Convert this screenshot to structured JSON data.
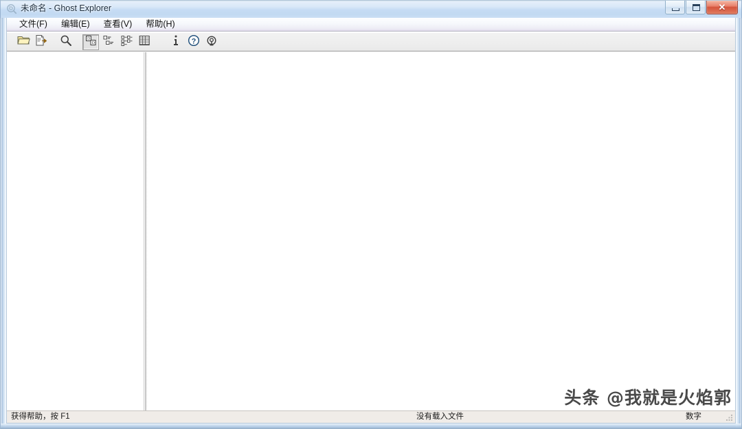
{
  "window": {
    "title": "未命名 - Ghost Explorer",
    "app_icon": "ghost-app-icon",
    "controls": {
      "minimize": "最小化",
      "maximize": "最大化",
      "close": "✕"
    },
    "accent_titlebar": "#c6dcf4",
    "accent_close": "#d4553d"
  },
  "menu": {
    "items": [
      {
        "label": "文件(F)",
        "name": "menu-file"
      },
      {
        "label": "编辑(E)",
        "name": "menu-edit"
      },
      {
        "label": "查看(V)",
        "name": "menu-view"
      },
      {
        "label": "帮助(H)",
        "name": "menu-help"
      }
    ]
  },
  "toolbar": {
    "buttons": [
      {
        "icon": "open-folder-icon",
        "label": "打开",
        "pressed": false
      },
      {
        "icon": "extract-file-icon",
        "label": "提取",
        "pressed": false
      },
      {
        "icon": "search-magnifier-icon",
        "label": "查找",
        "pressed": false
      },
      {
        "icon": "large-icons-view-icon",
        "label": "大图标",
        "pressed": true
      },
      {
        "icon": "small-icons-view-icon",
        "label": "小图标",
        "pressed": false
      },
      {
        "icon": "list-view-icon",
        "label": "列表",
        "pressed": false
      },
      {
        "icon": "details-view-icon",
        "label": "详细信息",
        "pressed": false
      },
      {
        "icon": "info-icon",
        "label": "信息",
        "pressed": false
      },
      {
        "icon": "help-question-icon",
        "label": "帮助",
        "pressed": false
      },
      {
        "icon": "ghost-about-icon",
        "label": "关于",
        "pressed": false
      }
    ]
  },
  "panes": {
    "tree_pane": {
      "name": "folder-tree-pane",
      "content": ""
    },
    "list_pane": {
      "name": "file-list-pane",
      "content": ""
    }
  },
  "statusbar": {
    "help_hint": "获得帮助，按 F1",
    "file_status": "没有载入文件",
    "mode": "数字",
    "grip": "resize-grip-icon"
  },
  "watermark": {
    "text": "头条 @我就是火焰郭"
  }
}
